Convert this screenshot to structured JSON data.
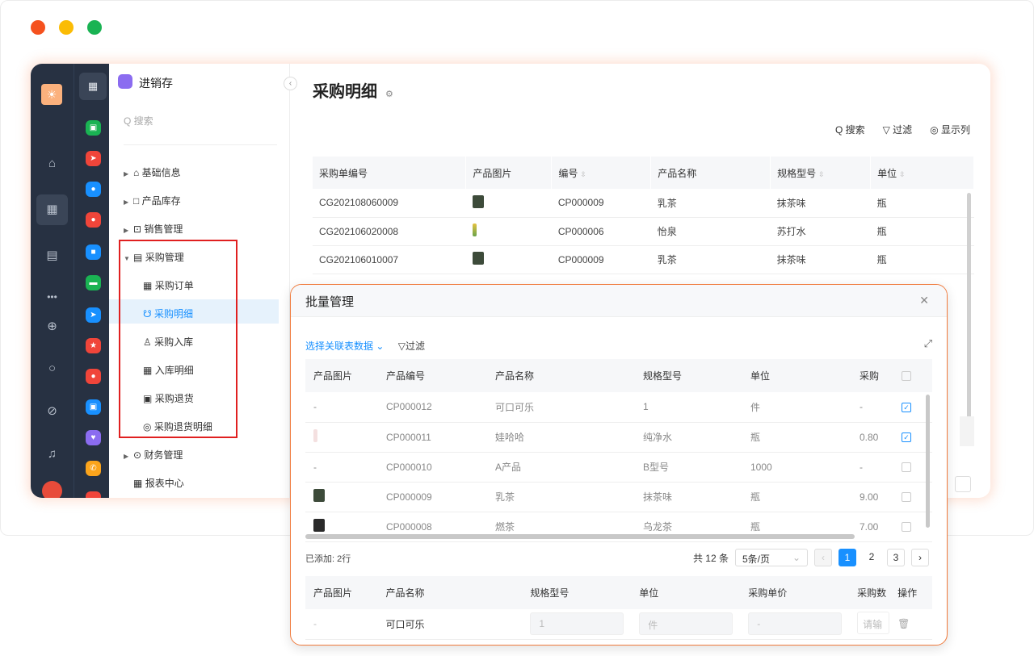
{
  "window": {
    "controls": [
      "#f5511e",
      "#fbbc05",
      "#1ab353"
    ]
  },
  "rail1": {
    "icons": [
      "home-icon",
      "grid-icon",
      "doc-icon",
      "more-icon",
      "plus-circle-icon",
      "search-icon",
      "help-icon",
      "bell-icon"
    ]
  },
  "nav": {
    "app_name": "进销存",
    "search_placeholder": "Q 搜索",
    "items": [
      {
        "label": "基础信息",
        "icon": "⌂"
      },
      {
        "label": "产品库存",
        "icon": "□"
      },
      {
        "label": "销售管理",
        "icon": "⊡"
      },
      {
        "label": "采购管理",
        "icon": "▤"
      }
    ],
    "sub_items": [
      {
        "label": "采购订单",
        "icon": "▦"
      },
      {
        "label": "采购明细",
        "icon": "☋"
      },
      {
        "label": "采购入库",
        "icon": "♙"
      },
      {
        "label": "入库明细",
        "icon": "▦"
      },
      {
        "label": "采购退货",
        "icon": "▣"
      },
      {
        "label": "采购退货明细",
        "icon": "◎"
      }
    ],
    "after_items": [
      {
        "label": "财务管理",
        "icon": "⊙"
      },
      {
        "label": "报表中心",
        "icon": "▦"
      }
    ]
  },
  "main": {
    "title": "采购明细",
    "toolbar": {
      "search": "Q 搜索",
      "filter": "▽ 过滤",
      "columns": "◎ 显示列"
    },
    "columns": [
      "采购单编号",
      "产品图片",
      "编号",
      "产品名称",
      "规格型号",
      "单位"
    ],
    "rows": [
      {
        "order": "CG202108060009",
        "code": "CP000009",
        "name": "乳茶",
        "spec": "抹茶味",
        "unit": "瓶"
      },
      {
        "order": "CG202106020008",
        "code": "CP000006",
        "name": "怡泉",
        "spec": "苏打水",
        "unit": "瓶"
      },
      {
        "order": "CG202106010007",
        "code": "CP000009",
        "name": "乳茶",
        "spec": "抹茶味",
        "unit": "瓶"
      }
    ]
  },
  "modal": {
    "title": "批量管理",
    "select_source": "选择关联表数据",
    "filter": "过滤",
    "columns": [
      "产品图片",
      "产品编号",
      "产品名称",
      "规格型号",
      "单位",
      "采购"
    ],
    "rows": [
      {
        "img": "-",
        "code": "CP000012",
        "name": "可口可乐",
        "spec": "1",
        "unit": "件",
        "price": "-",
        "checked": true
      },
      {
        "img": "",
        "code": "CP000011",
        "name": "娃哈哈",
        "spec": "纯净水",
        "unit": "瓶",
        "price": "0.80",
        "checked": true
      },
      {
        "img": "-",
        "code": "CP000010",
        "name": "A产品",
        "spec": "B型号",
        "unit": "1000",
        "price": "-",
        "checked": false
      },
      {
        "img": "",
        "code": "CP000009",
        "name": "乳茶",
        "spec": "抹茶味",
        "unit": "瓶",
        "price": "9.00",
        "checked": false
      },
      {
        "img": "",
        "code": "CP000008",
        "name": "燃茶",
        "spec": "乌龙茶",
        "unit": "瓶",
        "price": "7.00",
        "checked": false
      }
    ],
    "added_label": "已添加: 2行",
    "pager": {
      "total": "共 12 条",
      "size": "5条/页",
      "pages": [
        "1",
        "2",
        "3"
      ],
      "current": "1"
    },
    "bottom_columns": [
      "产品图片",
      "产品名称",
      "规格型号",
      "单位",
      "采购单价",
      "采购数",
      "操作"
    ],
    "bottom_row": {
      "img": "-",
      "name": "可口可乐",
      "spec": "1",
      "unit": "件",
      "price": "-",
      "qty_placeholder": "请输"
    }
  }
}
